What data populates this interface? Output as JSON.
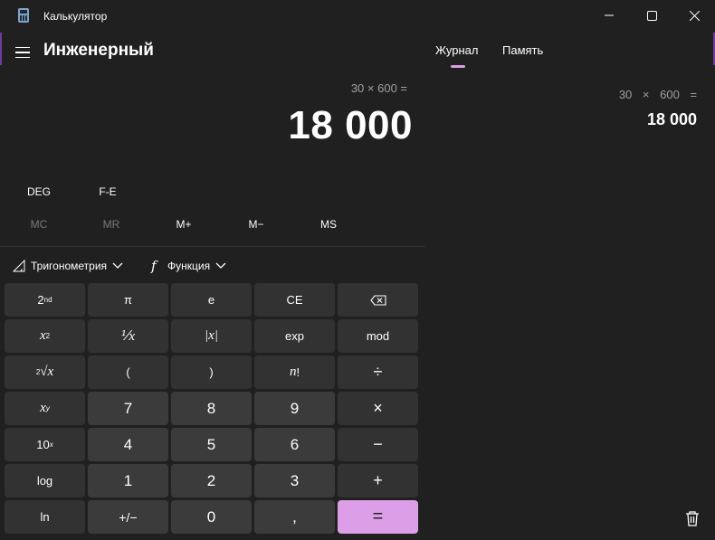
{
  "window": {
    "title": "Калькулятор",
    "icons": {
      "app": "calculator-icon",
      "minimize": "minimize-icon",
      "maximize": "maximize-icon",
      "close": "close-icon"
    }
  },
  "header": {
    "menu_icon": "hamburger-icon",
    "mode": "Инженерный"
  },
  "display": {
    "expression": "30 × 600 =",
    "value": "18 000"
  },
  "angle_row": {
    "angle": "DEG",
    "fe": "F-E"
  },
  "memory_row": [
    "MC",
    "MR",
    "M+",
    "M−",
    "MS"
  ],
  "dropdowns": {
    "trig": "Тригонометрия",
    "func": "Функция",
    "trig_icon": "triangle-icon",
    "func_icon": "function-icon",
    "chevron": "chevron-down-icon"
  },
  "keys": {
    "second": "2",
    "second_sup": "nd",
    "pi": "π",
    "e": "e",
    "ce": "CE",
    "backspace": "⌫",
    "x": "x",
    "square_sup": "2",
    "reciprocal": "⅟x",
    "abs": "|x|",
    "exp": "exp",
    "mod": "mod",
    "root_index": "2",
    "root_sign": "√x",
    "open_paren": "(",
    "close_paren": ")",
    "n": "n",
    "factorial_mark": "!",
    "divide": "÷",
    "power_sup": "y",
    "seven": "7",
    "eight": "8",
    "nine": "9",
    "multiply": "×",
    "ten": "10",
    "ten_sup": "x",
    "four": "4",
    "five": "5",
    "six": "6",
    "minus": "−",
    "log": "log",
    "one": "1",
    "two": "2",
    "three": "3",
    "plus": "+",
    "ln": "ln",
    "negate": "+/−",
    "zero": "0",
    "decimal": ",",
    "equals": "="
  },
  "history_panel": {
    "tabs": [
      "Журнал",
      "Память"
    ],
    "active_tab": "Журнал",
    "entry": {
      "expression": "30 × 600 =",
      "result": "18 000"
    },
    "trash_icon": "trash-icon"
  },
  "colors": {
    "background": "#202020",
    "key_function": "#323232",
    "key_number": "#3b3b3b",
    "accent": "#dc9ee6"
  }
}
